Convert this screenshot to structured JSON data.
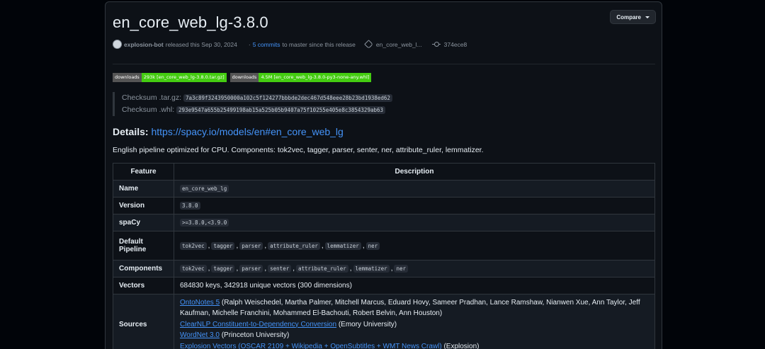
{
  "release": {
    "title": "en_core_web_lg-3.8.0",
    "compare_label": "Compare",
    "author": "explosion-bot",
    "released_text": "released this Sep 30, 2024",
    "commits_link": "5 commits",
    "commits_suffix": "to master since this release",
    "tag": "en_core_web_l...",
    "commit_hash": "374ece8"
  },
  "badges": [
    {
      "left": "downloads",
      "right": "293k [en_core_web_lg-3.8.0.tar.gz]"
    },
    {
      "left": "downloads",
      "right": "4.5M [en_core_web_lg-3.8.0-py3-none-any.whl]"
    }
  ],
  "checksums": [
    {
      "label": "Checksum .tar.gz:",
      "value": "7a3c89f3243950000a102c5f124277bbbde2dec467d548eee28b23bd1938ed62"
    },
    {
      "label": "Checksum .whl:",
      "value": "293e9547a655b25499198ab15a525b05b9407a75f10255e405e8c3854329ab63"
    }
  ],
  "details": {
    "label": "Details:",
    "url": "https://spacy.io/models/en#en_core_web_lg"
  },
  "description": "English pipeline optimized for CPU. Components: tok2vec, tagger, parser, senter, ner, attribute_ruler, lemmatizer.",
  "table": {
    "headers": [
      "Feature",
      "Description"
    ],
    "name": {
      "key": "Name",
      "value": "en_core_web_lg"
    },
    "version": {
      "key": "Version",
      "value": "3.8.0"
    },
    "spacy": {
      "key": "spaCy",
      "value": ">=3.8.0,<3.9.0"
    },
    "pipeline": {
      "key": "Default Pipeline",
      "values": [
        "tok2vec",
        "tagger",
        "parser",
        "attribute_ruler",
        "lemmatizer",
        "ner"
      ]
    },
    "components": {
      "key": "Components",
      "values": [
        "tok2vec",
        "tagger",
        "parser",
        "senter",
        "attribute_ruler",
        "lemmatizer",
        "ner"
      ]
    },
    "vectors": {
      "key": "Vectors",
      "value": "684830 keys, 342918 unique vectors (300 dimensions)"
    },
    "sources": {
      "key": "Sources",
      "items": [
        {
          "link": "OntoNotes 5",
          "text": " (Ralph Weischedel, Martha Palmer, Mitchell Marcus, Eduard Hovy, Sameer Pradhan, Lance Ramshaw, Nianwen Xue, Ann Taylor, Jeff Kaufman, Michelle Franchini, Mohammed El-Bachouti, Robert Belvin, Ann Houston)"
        },
        {
          "link": "ClearNLP Constituent-to-Dependency Conversion",
          "text": " (Emory University)"
        },
        {
          "link": "WordNet 3.0",
          "text": " (Princeton University)"
        },
        {
          "link": "Explosion Vectors (OSCAR 2109 + Wikipedia + OpenSubtitles + WMT News Crawl)",
          "text": " (Explosion)"
        }
      ]
    }
  }
}
